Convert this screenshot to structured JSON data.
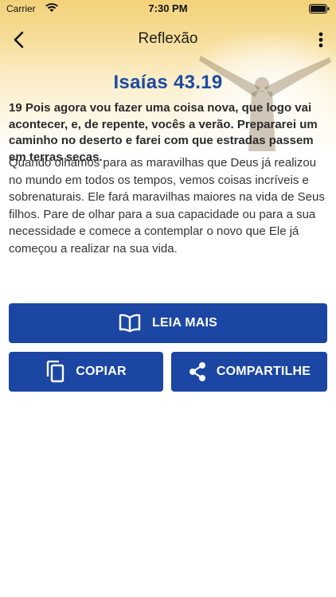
{
  "status_bar": {
    "carrier": "Carrier",
    "time": "7:30 PM"
  },
  "nav": {
    "title": "Reflexão",
    "back_icon": "chevron-left-icon",
    "more_icon": "more-vertical-icon"
  },
  "content": {
    "verse_reference": "Isaías 43.19",
    "verse_text": "19 Pois agora vou fazer uma coisa nova, que logo vai acontecer, e, de repente, vocês a verão. Prepararei um caminho no deserto e farei com que estradas passem em terras secas.",
    "reflection": "Quando olhamos para as maravilhas que Deus já realizou no mundo em todos os tempos, vemos coisas incríveis e sobrenaturais. Ele fará maravilhas maiores na vida de Seus filhos. Pare de olhar para a sua capacidade ou para a sua necessidade e comece a contemplar o novo que Ele já começou a realizar na sua vida."
  },
  "actions": {
    "read_more": "LEIA MAIS",
    "copy": "COPIAR",
    "share": "COMPARTILHE"
  },
  "colors": {
    "primary": "#1b46a3",
    "verse_ref": "#1d4aa0",
    "header_gold": "#f3d27a"
  }
}
